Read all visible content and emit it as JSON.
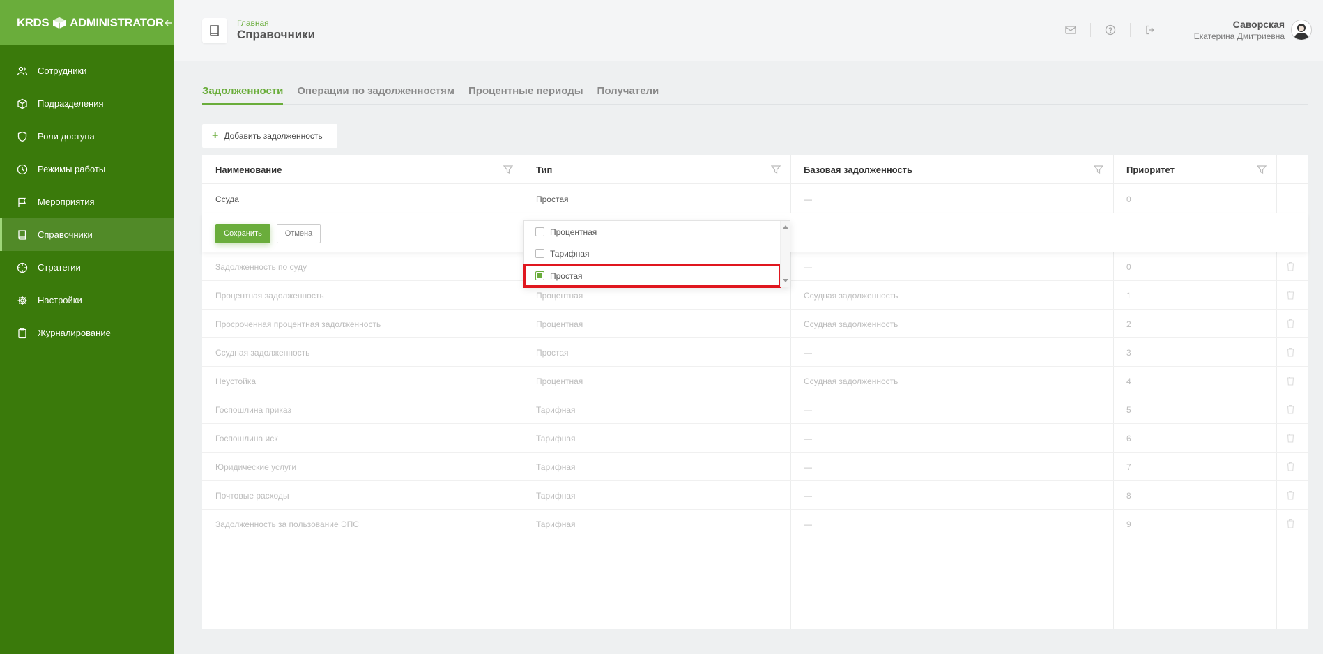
{
  "app": {
    "logo_left": "KRDS",
    "logo_right": "ADMINISTRATOR"
  },
  "sidebar": {
    "items": [
      {
        "label": "Сотрудники",
        "icon": "users-icon"
      },
      {
        "label": "Подразделения",
        "icon": "cube-icon"
      },
      {
        "label": "Роли доступа",
        "icon": "shield-icon"
      },
      {
        "label": "Режимы работы",
        "icon": "clock-icon"
      },
      {
        "label": "Мероприятия",
        "icon": "flag-icon"
      },
      {
        "label": "Справочники",
        "icon": "book-icon",
        "active": true
      },
      {
        "label": "Стратегии",
        "icon": "crosshair-icon"
      },
      {
        "label": "Настройки",
        "icon": "gear-icon"
      },
      {
        "label": "Журналирование",
        "icon": "clipboard-icon"
      }
    ]
  },
  "header": {
    "breadcrumb": "Главная",
    "title": "Справочники",
    "user_last": "Саворская",
    "user_first": "Екатерина Дмитриевна"
  },
  "tabs": [
    "Задолженности",
    "Операции по задолженностям",
    "Процентные периоды",
    "Получатели"
  ],
  "add_button": "Добавить задолженность",
  "table": {
    "headers": [
      "Наименование",
      "Тип",
      "Базовая задолженность",
      "Приоритет"
    ],
    "editing_row": [
      "Ссуда",
      "Простая",
      "—",
      "0"
    ],
    "save_label": "Сохранить",
    "cancel_label": "Отмена",
    "rows": [
      [
        "Задолженность по суду",
        "",
        "—",
        "0"
      ],
      [
        "Процентная задолженность",
        "Процентная",
        "Ссудная задолженность",
        "1"
      ],
      [
        "Просроченная процентная задолженность",
        "Процентная",
        "Ссудная задолженность",
        "2"
      ],
      [
        "Ссудная задолженность",
        "Простая",
        "—",
        "3"
      ],
      [
        "Неустойка",
        "Процентная",
        "Ссудная задолженность",
        "4"
      ],
      [
        "Госпошлина приказ",
        "Тарифная",
        "—",
        "5"
      ],
      [
        "Госпошлина иск",
        "Тарифная",
        "—",
        "6"
      ],
      [
        "Юридические услуги",
        "Тарифная",
        "—",
        "7"
      ],
      [
        "Почтовые расходы",
        "Тарифная",
        "—",
        "8"
      ],
      [
        "Задолженность за пользование ЭПС",
        "Тарифная",
        "—",
        "9"
      ]
    ]
  },
  "dropdown": {
    "options": [
      "Процентная",
      "Тарифная",
      "Простая"
    ],
    "selected": "Простая"
  },
  "colors": {
    "sidebar": "#3a7a0b",
    "accent": "#6aad3b",
    "highlight": "#e0171f"
  }
}
